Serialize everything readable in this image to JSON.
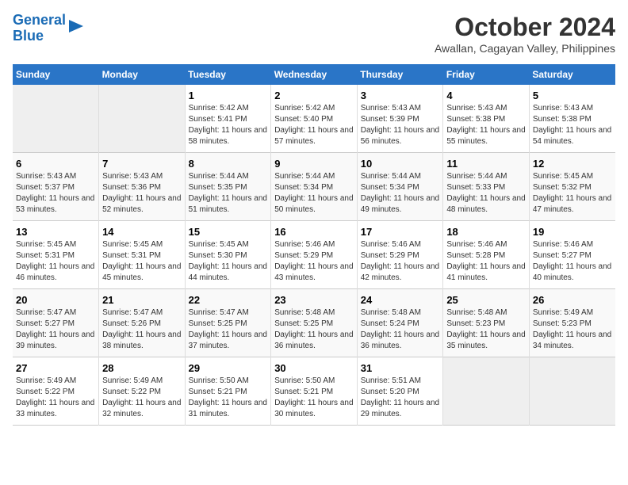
{
  "logo": {
    "line1": "General",
    "line2": "Blue"
  },
  "title": "October 2024",
  "subtitle": "Awallan, Cagayan Valley, Philippines",
  "days_of_week": [
    "Sunday",
    "Monday",
    "Tuesday",
    "Wednesday",
    "Thursday",
    "Friday",
    "Saturday"
  ],
  "weeks": [
    [
      {
        "day": "",
        "empty": true
      },
      {
        "day": "",
        "empty": true
      },
      {
        "day": "1",
        "sunrise": "Sunrise: 5:42 AM",
        "sunset": "Sunset: 5:41 PM",
        "daylight": "Daylight: 11 hours and 58 minutes."
      },
      {
        "day": "2",
        "sunrise": "Sunrise: 5:42 AM",
        "sunset": "Sunset: 5:40 PM",
        "daylight": "Daylight: 11 hours and 57 minutes."
      },
      {
        "day": "3",
        "sunrise": "Sunrise: 5:43 AM",
        "sunset": "Sunset: 5:39 PM",
        "daylight": "Daylight: 11 hours and 56 minutes."
      },
      {
        "day": "4",
        "sunrise": "Sunrise: 5:43 AM",
        "sunset": "Sunset: 5:38 PM",
        "daylight": "Daylight: 11 hours and 55 minutes."
      },
      {
        "day": "5",
        "sunrise": "Sunrise: 5:43 AM",
        "sunset": "Sunset: 5:38 PM",
        "daylight": "Daylight: 11 hours and 54 minutes."
      }
    ],
    [
      {
        "day": "6",
        "sunrise": "Sunrise: 5:43 AM",
        "sunset": "Sunset: 5:37 PM",
        "daylight": "Daylight: 11 hours and 53 minutes."
      },
      {
        "day": "7",
        "sunrise": "Sunrise: 5:43 AM",
        "sunset": "Sunset: 5:36 PM",
        "daylight": "Daylight: 11 hours and 52 minutes."
      },
      {
        "day": "8",
        "sunrise": "Sunrise: 5:44 AM",
        "sunset": "Sunset: 5:35 PM",
        "daylight": "Daylight: 11 hours and 51 minutes."
      },
      {
        "day": "9",
        "sunrise": "Sunrise: 5:44 AM",
        "sunset": "Sunset: 5:34 PM",
        "daylight": "Daylight: 11 hours and 50 minutes."
      },
      {
        "day": "10",
        "sunrise": "Sunrise: 5:44 AM",
        "sunset": "Sunset: 5:34 PM",
        "daylight": "Daylight: 11 hours and 49 minutes."
      },
      {
        "day": "11",
        "sunrise": "Sunrise: 5:44 AM",
        "sunset": "Sunset: 5:33 PM",
        "daylight": "Daylight: 11 hours and 48 minutes."
      },
      {
        "day": "12",
        "sunrise": "Sunrise: 5:45 AM",
        "sunset": "Sunset: 5:32 PM",
        "daylight": "Daylight: 11 hours and 47 minutes."
      }
    ],
    [
      {
        "day": "13",
        "sunrise": "Sunrise: 5:45 AM",
        "sunset": "Sunset: 5:31 PM",
        "daylight": "Daylight: 11 hours and 46 minutes."
      },
      {
        "day": "14",
        "sunrise": "Sunrise: 5:45 AM",
        "sunset": "Sunset: 5:31 PM",
        "daylight": "Daylight: 11 hours and 45 minutes."
      },
      {
        "day": "15",
        "sunrise": "Sunrise: 5:45 AM",
        "sunset": "Sunset: 5:30 PM",
        "daylight": "Daylight: 11 hours and 44 minutes."
      },
      {
        "day": "16",
        "sunrise": "Sunrise: 5:46 AM",
        "sunset": "Sunset: 5:29 PM",
        "daylight": "Daylight: 11 hours and 43 minutes."
      },
      {
        "day": "17",
        "sunrise": "Sunrise: 5:46 AM",
        "sunset": "Sunset: 5:29 PM",
        "daylight": "Daylight: 11 hours and 42 minutes."
      },
      {
        "day": "18",
        "sunrise": "Sunrise: 5:46 AM",
        "sunset": "Sunset: 5:28 PM",
        "daylight": "Daylight: 11 hours and 41 minutes."
      },
      {
        "day": "19",
        "sunrise": "Sunrise: 5:46 AM",
        "sunset": "Sunset: 5:27 PM",
        "daylight": "Daylight: 11 hours and 40 minutes."
      }
    ],
    [
      {
        "day": "20",
        "sunrise": "Sunrise: 5:47 AM",
        "sunset": "Sunset: 5:27 PM",
        "daylight": "Daylight: 11 hours and 39 minutes."
      },
      {
        "day": "21",
        "sunrise": "Sunrise: 5:47 AM",
        "sunset": "Sunset: 5:26 PM",
        "daylight": "Daylight: 11 hours and 38 minutes."
      },
      {
        "day": "22",
        "sunrise": "Sunrise: 5:47 AM",
        "sunset": "Sunset: 5:25 PM",
        "daylight": "Daylight: 11 hours and 37 minutes."
      },
      {
        "day": "23",
        "sunrise": "Sunrise: 5:48 AM",
        "sunset": "Sunset: 5:25 PM",
        "daylight": "Daylight: 11 hours and 36 minutes."
      },
      {
        "day": "24",
        "sunrise": "Sunrise: 5:48 AM",
        "sunset": "Sunset: 5:24 PM",
        "daylight": "Daylight: 11 hours and 36 minutes."
      },
      {
        "day": "25",
        "sunrise": "Sunrise: 5:48 AM",
        "sunset": "Sunset: 5:23 PM",
        "daylight": "Daylight: 11 hours and 35 minutes."
      },
      {
        "day": "26",
        "sunrise": "Sunrise: 5:49 AM",
        "sunset": "Sunset: 5:23 PM",
        "daylight": "Daylight: 11 hours and 34 minutes."
      }
    ],
    [
      {
        "day": "27",
        "sunrise": "Sunrise: 5:49 AM",
        "sunset": "Sunset: 5:22 PM",
        "daylight": "Daylight: 11 hours and 33 minutes."
      },
      {
        "day": "28",
        "sunrise": "Sunrise: 5:49 AM",
        "sunset": "Sunset: 5:22 PM",
        "daylight": "Daylight: 11 hours and 32 minutes."
      },
      {
        "day": "29",
        "sunrise": "Sunrise: 5:50 AM",
        "sunset": "Sunset: 5:21 PM",
        "daylight": "Daylight: 11 hours and 31 minutes."
      },
      {
        "day": "30",
        "sunrise": "Sunrise: 5:50 AM",
        "sunset": "Sunset: 5:21 PM",
        "daylight": "Daylight: 11 hours and 30 minutes."
      },
      {
        "day": "31",
        "sunrise": "Sunrise: 5:51 AM",
        "sunset": "Sunset: 5:20 PM",
        "daylight": "Daylight: 11 hours and 29 minutes."
      },
      {
        "day": "",
        "empty": true
      },
      {
        "day": "",
        "empty": true
      }
    ]
  ]
}
